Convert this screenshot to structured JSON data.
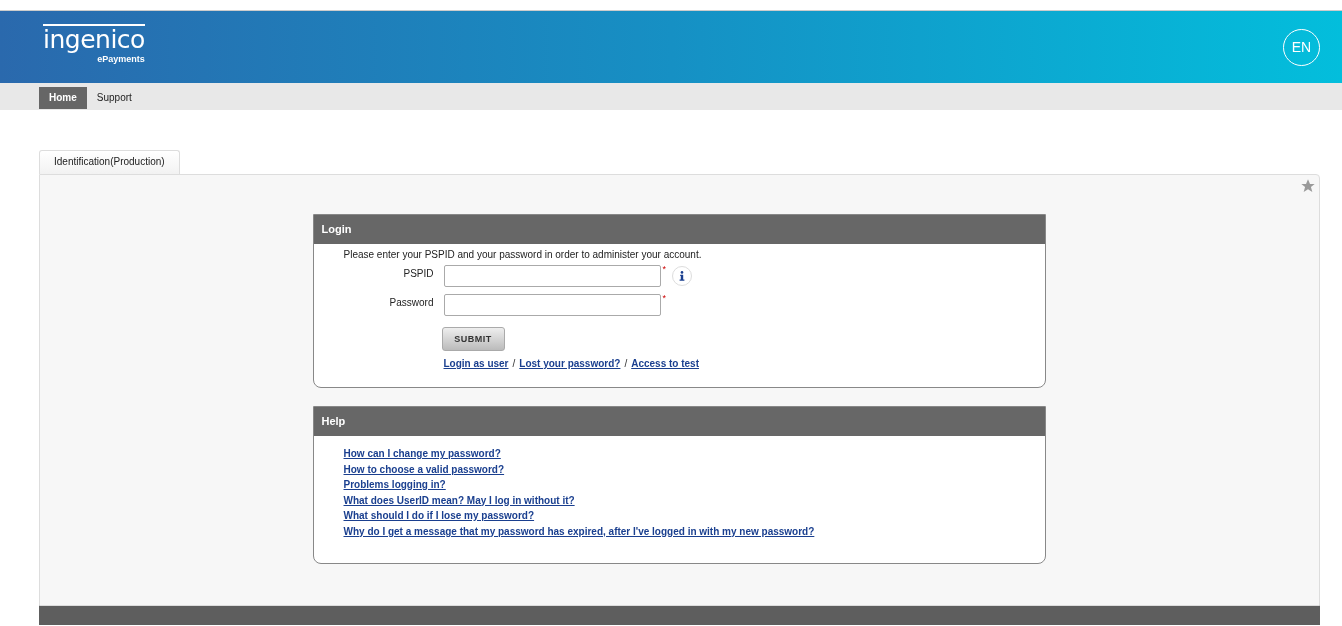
{
  "header": {
    "logo": "ingenico",
    "logo_sub": "ePayments",
    "language": "EN"
  },
  "nav": [
    {
      "label": "Home",
      "selected": true
    },
    {
      "label": "Support",
      "selected": false
    }
  ],
  "tabs": [
    {
      "label": "Identification(Production)",
      "selected": true
    }
  ],
  "login": {
    "title": "Login",
    "intro": "Please enter your PSPID and your password in order to administer your account.",
    "fields": [
      {
        "label": "PSPID",
        "required": "*",
        "info": true
      },
      {
        "label": "Password",
        "required": "*",
        "info": false
      }
    ],
    "submit": "SUBMIT",
    "links": [
      {
        "text": "Login as user"
      },
      {
        "text": "Lost your password?"
      },
      {
        "text": "Access to test"
      }
    ],
    "separator": "/"
  },
  "help": {
    "title": "Help",
    "links": [
      {
        "text": "How can I change my password?"
      },
      {
        "text": "How to choose a valid password?"
      },
      {
        "text": "Problems logging in?"
      },
      {
        "text": "What does UserID mean? May I log in without it?"
      },
      {
        "text": "What should I do if I lose my password?"
      },
      {
        "text": "Why do I get a message that my password has expired, after I've logged in with my new password?"
      }
    ]
  }
}
